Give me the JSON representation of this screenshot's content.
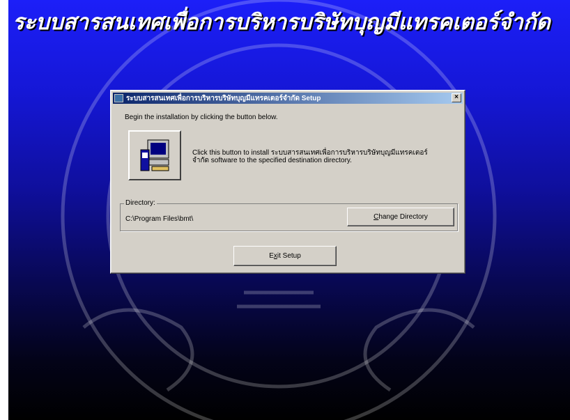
{
  "banner": {
    "text": "ระบบสารสนเทศเพื่อการบริหารบริษัทบุญมีแทรคเตอร์จำกัด"
  },
  "dialog": {
    "title": "ระบบสารสนเทศเพื่อการบริหารบริษัทบุญมีแทรคเตอร์จำกัด Setup",
    "close_label": "×",
    "intro": "Begin the installation by clicking the button below.",
    "install_text": "Click this button to install ระบบสารสนเทศเพื่อการบริหารบริษัทบุญมีแทรคเตอร์จำกัด software to the specified destination directory.",
    "directory_label": "Directory:",
    "directory_path": "C:\\Program Files\\bmt\\",
    "change_dir_button": {
      "mnemonic": "C",
      "rest": "hange Directory"
    },
    "exit_button": {
      "before": "E",
      "mnemonic": "x",
      "after": "it Setup"
    }
  },
  "icons": {
    "install": "computer-install-icon",
    "title": "setup-icon",
    "close": "close-icon"
  },
  "colors": {
    "desktop_top": "#1c1ff8",
    "desktop_bottom": "#000000",
    "dialog_face": "#d4d0c8",
    "titlebar": "#0a246a"
  }
}
